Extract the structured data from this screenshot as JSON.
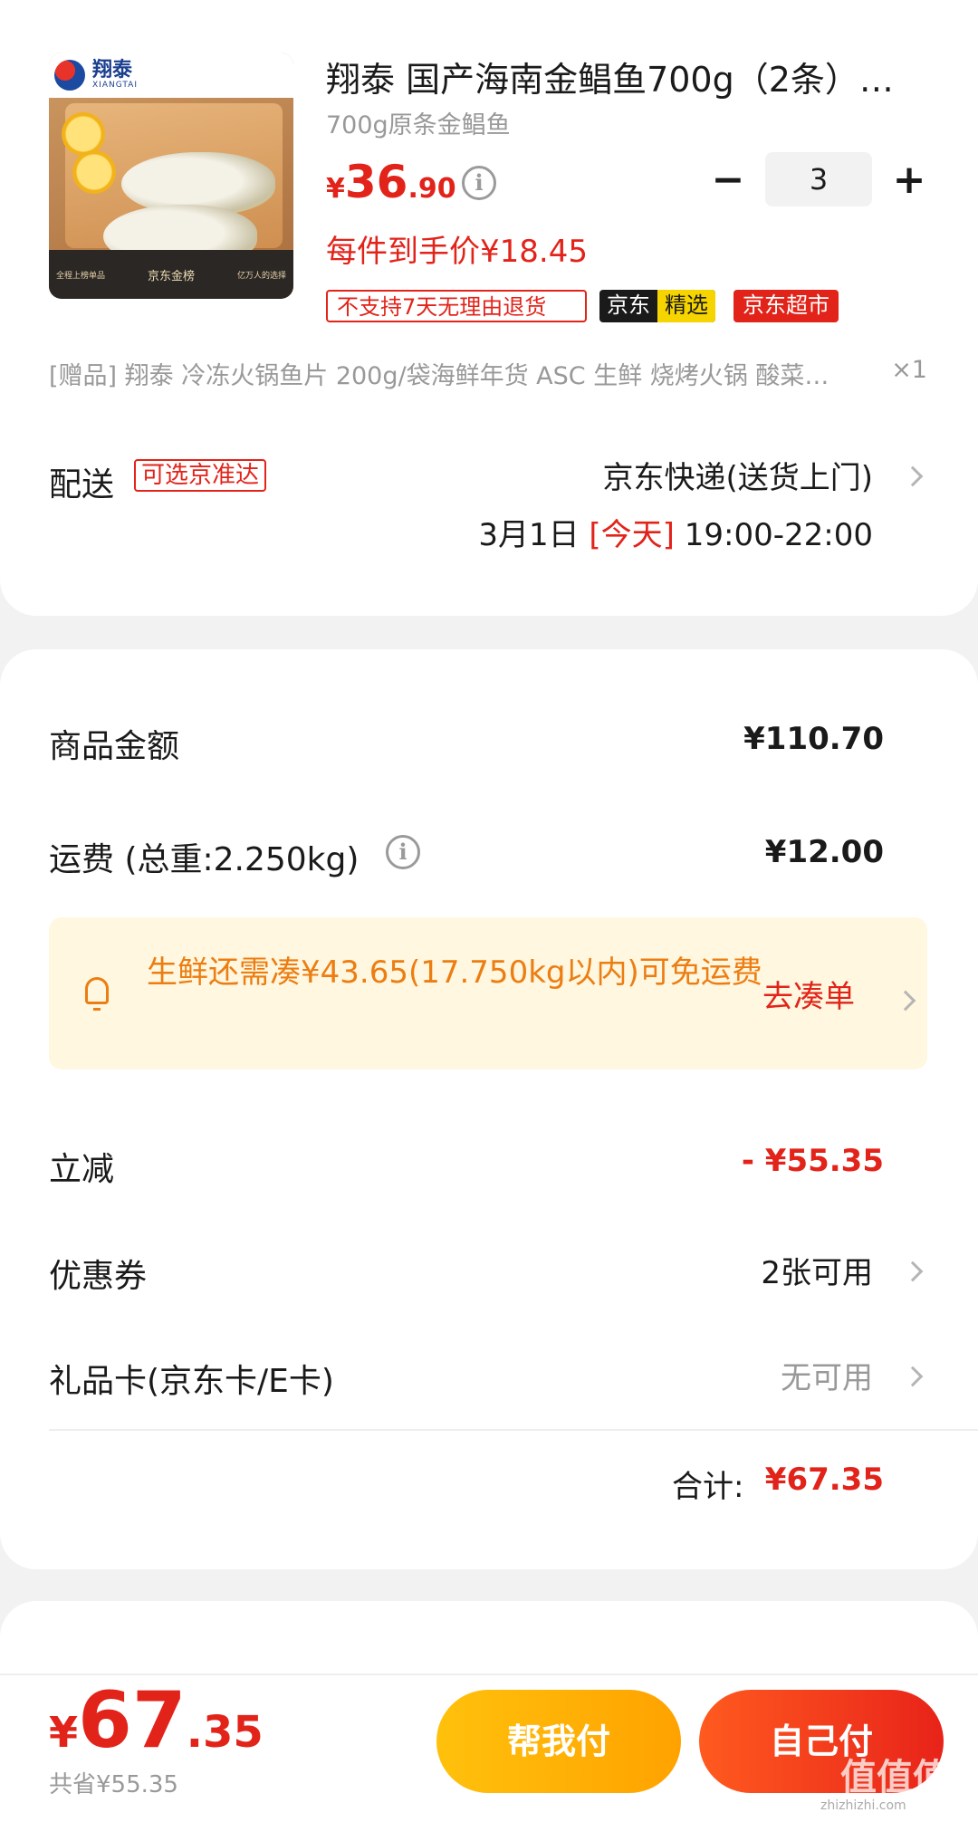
{
  "product": {
    "brand": "翔泰",
    "brand_en": "XIANGTAI",
    "image_footer_left": "全程上榜单品",
    "image_footer_mid": "京东金榜",
    "image_footer_right": "亿万人的选择",
    "title": "翔泰 国产海南金鲳鱼700g（2条）海…",
    "spec": "700g原条金鲳鱼",
    "price_currency": "¥",
    "price_int": "36",
    "price_dec": ".90",
    "quantity": "3",
    "unit_price": "每件到手价¥18.45",
    "tags": {
      "return": "不支持7天无理由退货",
      "jd_pick_a": "京东",
      "jd_pick_b": "精选",
      "jd_super": "京东超市"
    },
    "gift": "[赠品]   翔泰 冷冻火锅鱼片 200g/袋海鲜年货 ASC 生鲜 烧烤火锅 酸菜…",
    "gift_qty": "×1"
  },
  "delivery": {
    "label": "配送",
    "tag": "可选京准达",
    "method": "京东快递(送货上门)",
    "date": "3月1日",
    "today": "[今天]",
    "time": "19:00-22:00"
  },
  "summary": {
    "goods_label": "商品金额",
    "goods_value": "¥110.70",
    "freight_label": "运费 (总重:2.250kg)",
    "freight_value": "¥12.00",
    "notice_text": "生鲜还需凑¥43.65(17.750kg以内)可免运费",
    "notice_action": "去凑单",
    "discount_label": "立减",
    "discount_value": "- ¥55.35",
    "coupon_label": "优惠券",
    "coupon_value": "2张可用",
    "giftcard_label": "礼品卡(京东卡/E卡)",
    "giftcard_value": "无可用",
    "total_label": "合计:",
    "total_value": "¥67.35"
  },
  "bottom": {
    "currency": "¥",
    "total_int": "67",
    "total_dec": ".35",
    "saved": "共省¥55.35",
    "help_pay": "帮我付",
    "self_pay": "自己付",
    "watermark": "值值值",
    "watermark_url": "zhizhizhi.com"
  },
  "colors": {
    "accent_red": "#e2231a",
    "notice_orange": "#ec7d12",
    "help_btn": "#ffb000"
  },
  "icons": [
    "info-icon",
    "chevron-right-icon",
    "bell-icon",
    "minus-icon",
    "plus-icon"
  ]
}
